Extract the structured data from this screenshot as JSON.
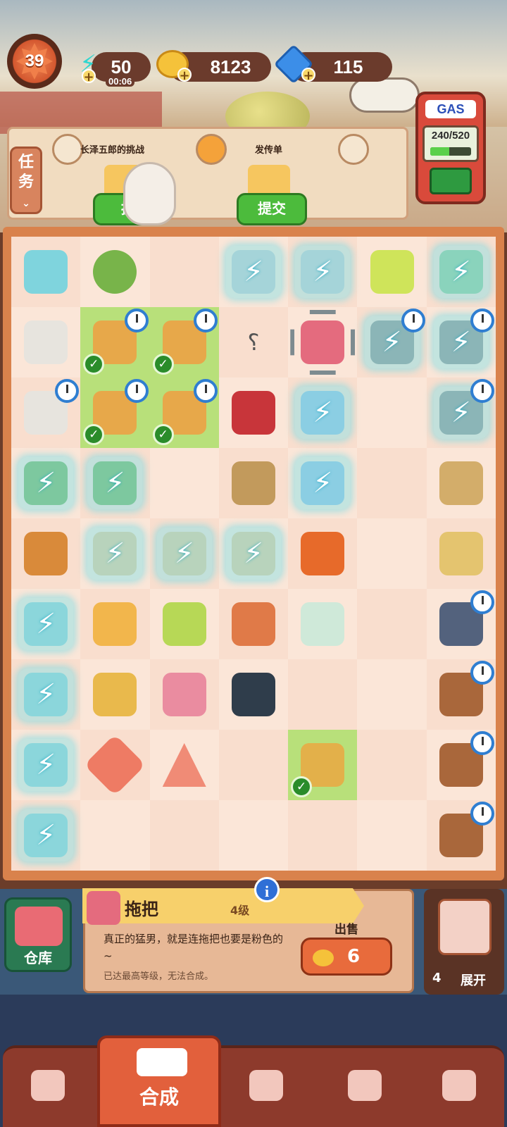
{
  "player": {
    "level": "39"
  },
  "resources": {
    "energy": {
      "value": "50",
      "timer": "00:06",
      "icon": "lightning-icon"
    },
    "paws": {
      "value": "8123",
      "icon": "paw-coin-icon"
    },
    "gems": {
      "value": "115",
      "icon": "gem-icon"
    }
  },
  "gas_pump": {
    "label": "GAS",
    "capacity": "240/520",
    "fill_fraction": 0.46
  },
  "tasks_tab": {
    "label": "任务"
  },
  "orders": [
    {
      "title": "长泽五郎的挑战",
      "button": "提",
      "avatar": "old-man-avatar"
    },
    {
      "title": "发传单",
      "button": "提交",
      "avatar": "megaphone-icon"
    },
    {
      "title": "",
      "button": "",
      "avatar": "young-man-avatar"
    }
  ],
  "board": {
    "rows": [
      [
        {
          "item": "jar",
          "icon": "jar-icon"
        },
        {
          "item": "leaf",
          "icon": "sprout-icon"
        },
        {
          "item": ""
        },
        {
          "item": "safe",
          "locked": true
        },
        {
          "item": "safe",
          "locked": true
        },
        {
          "item": "cocktail",
          "icon": "martini-icon"
        },
        {
          "item": "car",
          "locked": true
        }
      ],
      [
        {
          "item": "printer",
          "icon": "printer-icon"
        },
        {
          "item": "box",
          "check": true,
          "clock": true
        },
        {
          "item": "box",
          "check": true,
          "clock": true
        },
        {
          "item": "hook",
          "icon": "hook-icon"
        },
        {
          "item": "mop",
          "selected": true
        },
        {
          "item": "bin",
          "locked": true,
          "clock": true
        },
        {
          "item": "bin",
          "locked": true,
          "clock": true
        }
      ],
      [
        {
          "item": "printer2",
          "icon": "printer-icon",
          "clock": true
        },
        {
          "item": "box",
          "check": true,
          "clock": true
        },
        {
          "item": "box",
          "check": true,
          "clock": true
        },
        {
          "item": "cup",
          "icon": "jam-cup-icon"
        },
        {
          "item": "notepad",
          "locked": true
        },
        {
          "item": ""
        },
        {
          "item": "bin",
          "locked": true,
          "clock": true
        }
      ],
      [
        {
          "item": "plant",
          "locked": true
        },
        {
          "item": "plant",
          "locked": true
        },
        {
          "item": ""
        },
        {
          "item": "beans",
          "icon": "beans-bag-icon"
        },
        {
          "item": "notebook",
          "locked": true
        },
        {
          "item": ""
        },
        {
          "item": "flatbread",
          "icon": "flatbread-icon"
        }
      ],
      [
        {
          "item": "mug",
          "icon": "drink-mug-icon"
        },
        {
          "item": "crate",
          "locked": true
        },
        {
          "item": "crate",
          "locked": true
        },
        {
          "item": "crate",
          "locked": true
        },
        {
          "item": "cocktail2",
          "icon": "tequila-sunrise-icon"
        },
        {
          "item": ""
        },
        {
          "item": "takeout-bag",
          "icon": "takeout-bag-icon"
        }
      ],
      [
        {
          "item": "pot",
          "locked": true
        },
        {
          "item": "beer",
          "icon": "beer-glass-icon"
        },
        {
          "item": "juice",
          "icon": "juice-glass-icon"
        },
        {
          "item": "whiskey",
          "icon": "whiskey-glass-icon"
        },
        {
          "item": "bottle",
          "icon": "glue-bottle-icon"
        },
        {
          "item": ""
        },
        {
          "item": "apron",
          "icon": "apron-icon",
          "clock": true
        }
      ],
      [
        {
          "item": "pot",
          "locked": true
        },
        {
          "item": "goblet",
          "icon": "goblet-icon"
        },
        {
          "item": "bucket",
          "icon": "bucket-icon"
        },
        {
          "item": "stew",
          "icon": "stew-pot-icon"
        },
        {
          "item": ""
        },
        {
          "item": ""
        },
        {
          "item": "barrel",
          "icon": "barrel-icon",
          "clock": true
        }
      ],
      [
        {
          "item": "pot",
          "locked": true
        },
        {
          "item": "star",
          "icon": "star-cookie-icon"
        },
        {
          "item": "triangle",
          "icon": "triangle-cookie-icon"
        },
        {
          "item": ""
        },
        {
          "item": "buddha-soup",
          "check": true,
          "icon": "buddha-soup-icon",
          "selected": true
        },
        {
          "item": ""
        },
        {
          "item": "barrel",
          "icon": "barrel-icon",
          "clock": true
        }
      ],
      [
        {
          "item": "pot",
          "locked": true
        },
        {
          "item": ""
        },
        {
          "item": ""
        },
        {
          "item": ""
        },
        {
          "item": ""
        },
        {
          "item": ""
        },
        {
          "item": "barrel",
          "icon": "barrel-icon",
          "clock": true
        }
      ]
    ]
  },
  "warehouse": {
    "label": "仓库"
  },
  "info_panel": {
    "item_name": "拖把",
    "item_level": "4级",
    "description": "真正的猛男，就是连拖把也要是粉色的~",
    "note": "已达最高等级，无法合成。",
    "sell_label": "出售",
    "sell_price": "6"
  },
  "expand": {
    "count": "4",
    "label": "展开"
  },
  "nav": {
    "active_label": "合成",
    "items": [
      "bag-icon",
      "merge-icon",
      "cloche-icon",
      "map-icon",
      "bus-icon"
    ]
  }
}
